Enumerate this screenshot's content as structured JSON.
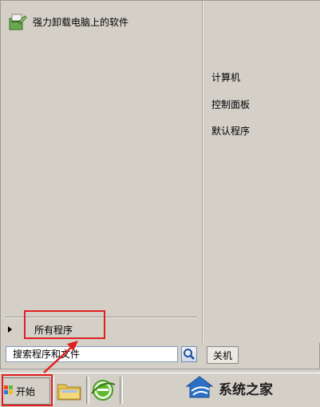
{
  "start_menu": {
    "pinned_programs": [
      {
        "label": "强力卸载电脑上的软件",
        "icon": "uninstall-app-icon"
      }
    ],
    "all_programs_label": "所有程序",
    "right_pane": {
      "items": [
        {
          "label": "计算机"
        },
        {
          "label": "控制面板"
        },
        {
          "label": "默认程序"
        }
      ]
    },
    "search": {
      "value": "",
      "placeholder": "搜索程序和文件",
      "icon": "search-icon"
    },
    "shutdown_label": "关机"
  },
  "taskbar": {
    "start_label": "开始",
    "start_icon": "windows-logo-icon",
    "pinned": [
      {
        "icon": "file-explorer-icon"
      },
      {
        "icon": "internet-explorer-icon"
      }
    ]
  },
  "watermark": {
    "brand": "系统之家",
    "icon": "house-logo-icon"
  },
  "colors": {
    "highlight": "#e02020",
    "menu_background": "#d4d0c8"
  }
}
